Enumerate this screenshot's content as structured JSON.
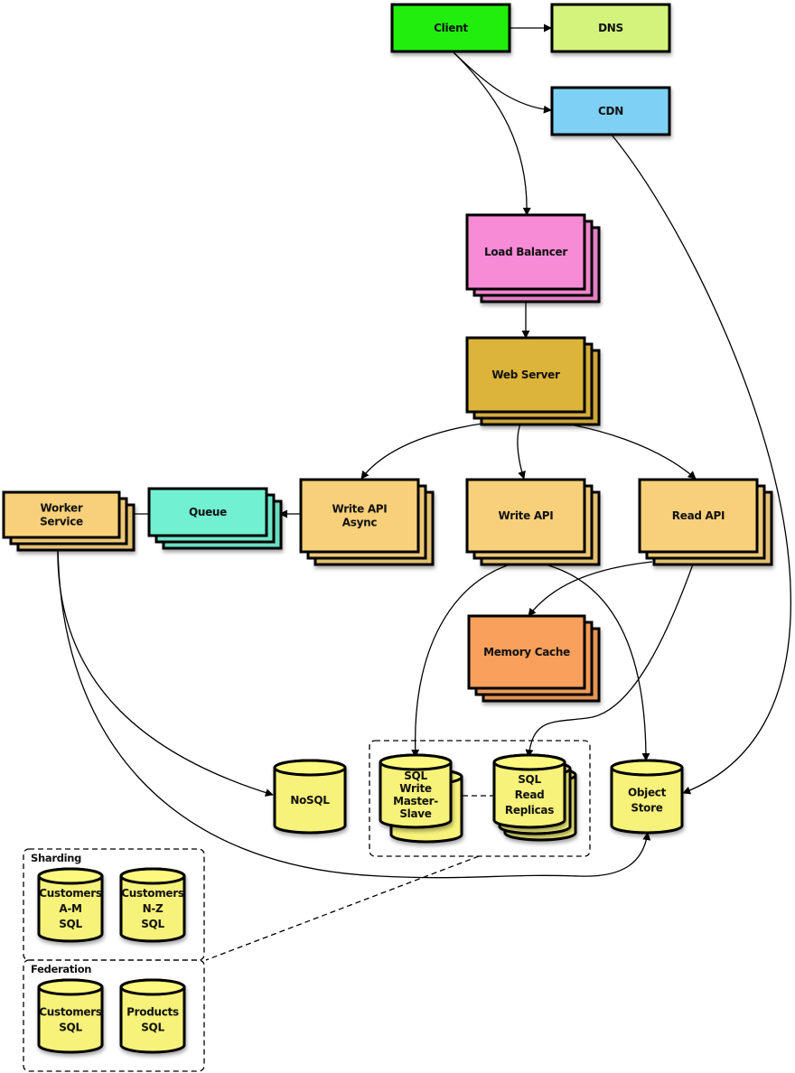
{
  "diagram": {
    "title": "",
    "nodes": {
      "client": {
        "label": [
          "Client"
        ],
        "color": "#22ee11",
        "kind": "box"
      },
      "dns": {
        "label": [
          "DNS"
        ],
        "color": "#d4f37c",
        "kind": "box"
      },
      "cdn": {
        "label": [
          "CDN"
        ],
        "color": "#7fd0f5",
        "kind": "box"
      },
      "load_balancer": {
        "label": [
          "Load Balancer"
        ],
        "color": "#f78bd6",
        "kind": "stack"
      },
      "web_server": {
        "label": [
          "Web Server"
        ],
        "color": "#dcb43a",
        "kind": "stack"
      },
      "write_api_async": {
        "label": [
          "Write API",
          "Async"
        ],
        "color": "#f8d07a",
        "kind": "stack"
      },
      "write_api": {
        "label": [
          "Write API"
        ],
        "color": "#f8d07a",
        "kind": "stack"
      },
      "read_api": {
        "label": [
          "Read API"
        ],
        "color": "#f8d07a",
        "kind": "stack"
      },
      "queue": {
        "label": [
          "Queue"
        ],
        "color": "#72f0d2",
        "kind": "stack"
      },
      "worker_service": {
        "label": [
          "Worker",
          "Service"
        ],
        "color": "#f8d07a",
        "kind": "stack"
      },
      "memory_cache": {
        "label": [
          "Memory Cache"
        ],
        "color": "#f9a05c",
        "kind": "stack"
      },
      "nosql": {
        "label": [
          "NoSQL"
        ],
        "color": "#f6f27a",
        "kind": "db"
      },
      "sql_write": {
        "label": [
          "SQL",
          "Write",
          "Master-",
          "Slave"
        ],
        "color": "#f6f27a",
        "kind": "db-pair"
      },
      "sql_read": {
        "label": [
          "SQL",
          "Read",
          "Replicas"
        ],
        "color": "#f6f27a",
        "kind": "db-stack"
      },
      "object_store": {
        "label": [
          "Object",
          "Store"
        ],
        "color": "#f6f27a",
        "kind": "db"
      },
      "customers_am": {
        "label": [
          "Customers",
          "A-M",
          "SQL"
        ],
        "color": "#f6f27a",
        "kind": "db"
      },
      "customers_nz": {
        "label": [
          "Customers",
          "N-Z",
          "SQL"
        ],
        "color": "#f6f27a",
        "kind": "db"
      },
      "customers_sql": {
        "label": [
          "Customers",
          "SQL"
        ],
        "color": "#f6f27a",
        "kind": "db"
      },
      "products_sql": {
        "label": [
          "Products",
          "SQL"
        ],
        "color": "#f6f27a",
        "kind": "db"
      }
    },
    "groups": {
      "sql_cluster": {
        "label": ""
      },
      "sharding": {
        "label": "Sharding"
      },
      "federation": {
        "label": "Federation"
      }
    },
    "edges": [
      {
        "from": "client",
        "to": "dns",
        "style": "solid"
      },
      {
        "from": "client",
        "to": "cdn",
        "style": "solid"
      },
      {
        "from": "client",
        "to": "load_balancer",
        "style": "solid"
      },
      {
        "from": "cdn",
        "to": "object_store",
        "style": "solid"
      },
      {
        "from": "load_balancer",
        "to": "web_server",
        "style": "solid"
      },
      {
        "from": "web_server",
        "to": "write_api_async",
        "style": "solid"
      },
      {
        "from": "web_server",
        "to": "write_api",
        "style": "solid"
      },
      {
        "from": "web_server",
        "to": "read_api",
        "style": "solid"
      },
      {
        "from": "write_api_async",
        "to": "queue",
        "style": "solid"
      },
      {
        "from": "queue",
        "to": "worker_service",
        "style": "solid"
      },
      {
        "from": "write_api",
        "to": "sql_write",
        "style": "solid"
      },
      {
        "from": "write_api",
        "to": "object_store",
        "style": "solid"
      },
      {
        "from": "read_api",
        "to": "memory_cache",
        "style": "solid"
      },
      {
        "from": "read_api",
        "to": "sql_read",
        "style": "solid"
      },
      {
        "from": "worker_service",
        "to": "nosql",
        "style": "solid"
      },
      {
        "from": "worker_service",
        "to": "object_store",
        "style": "solid"
      },
      {
        "from": "sql_write",
        "to": "sql_read",
        "style": "dashed"
      },
      {
        "from": "sql_cluster",
        "to": "federation",
        "style": "dashed"
      }
    ]
  }
}
